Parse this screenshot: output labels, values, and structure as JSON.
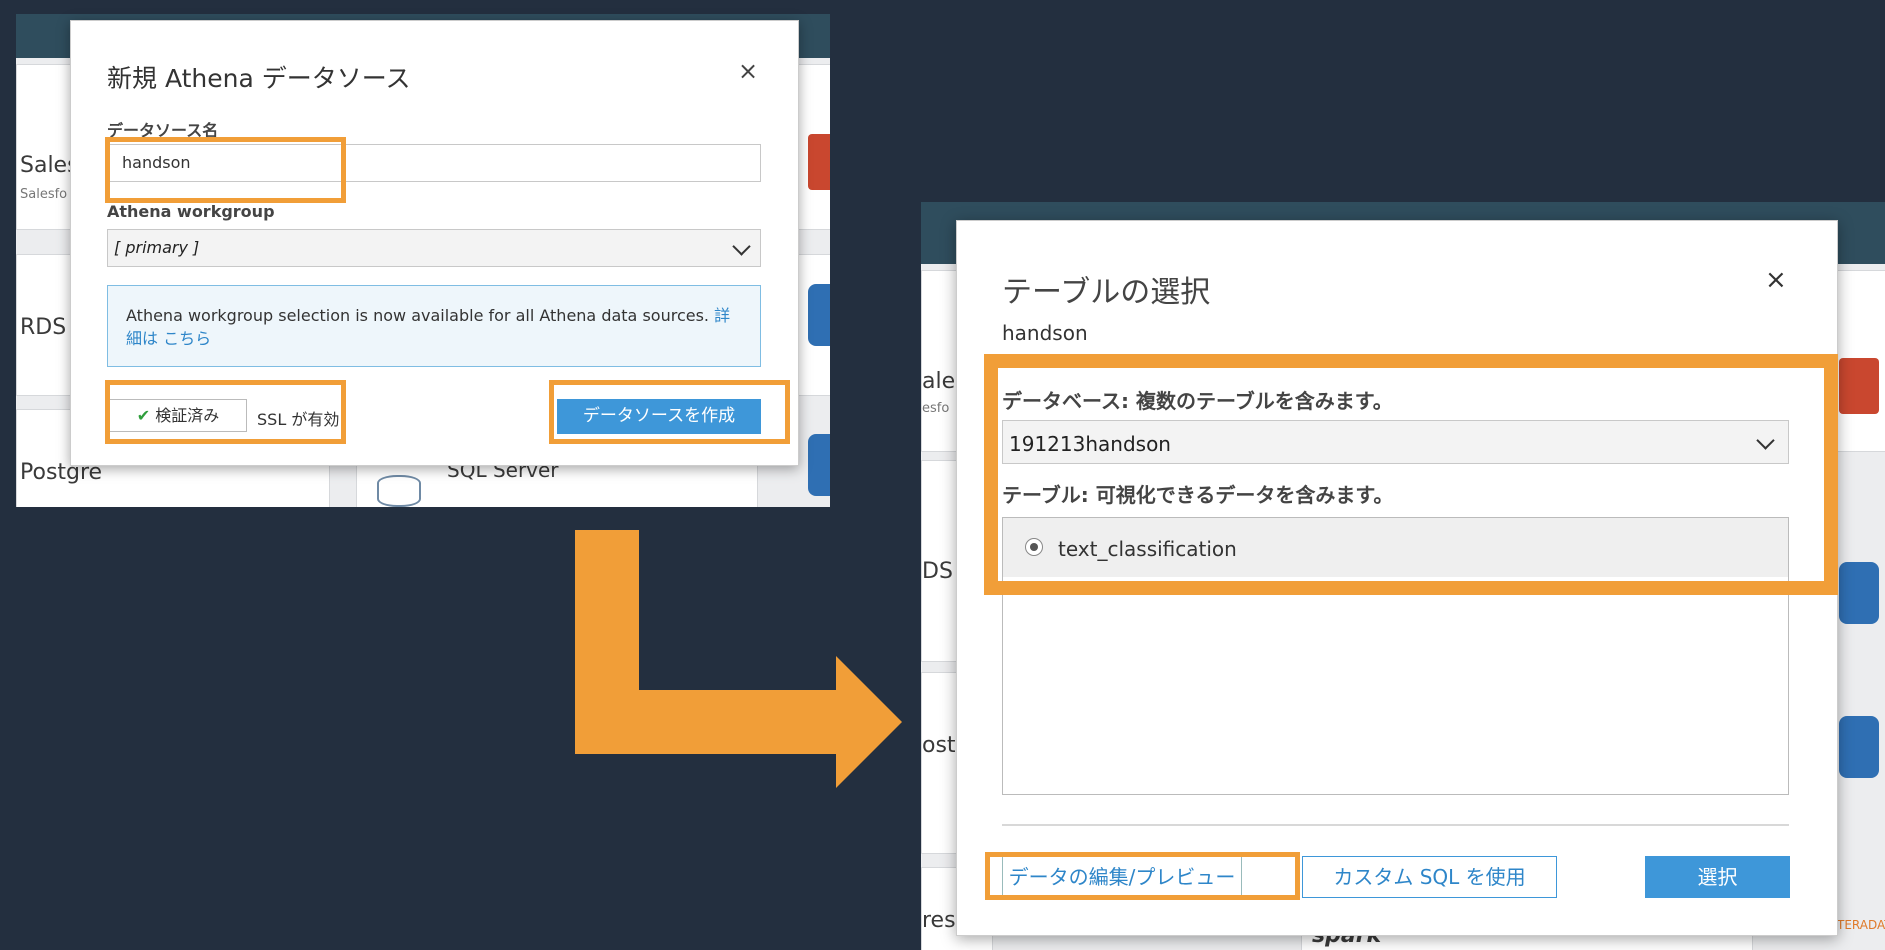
{
  "left_background": {
    "cards": [
      {
        "title": "Sales",
        "sub": "Salesfo"
      },
      {
        "title": "RDS"
      },
      {
        "title": "Postgre",
        "sub2": "SQL Server"
      }
    ]
  },
  "modal_left": {
    "title": "新規 Athena データソース",
    "close": "×",
    "datasource_label": "データソース名",
    "datasource_value": "handson",
    "workgroup_label": "Athena workgroup",
    "workgroup_value": "[ primary ]",
    "info_text": "Athena workgroup selection is now available for all Athena data sources. ",
    "info_link": "詳細は こちら",
    "verified_button": "検証済み",
    "verified_icon": "✔",
    "ssl_text": "SSL が有効",
    "create_button": "データソースを作成"
  },
  "right_background": {
    "cards": [
      {
        "title": "ales",
        "sub": "esfo"
      },
      {
        "title": "DS"
      },
      {
        "title": "ostg"
      },
      {
        "title": "rest"
      },
      {
        "title": "spark"
      },
      {
        "title": "TERADATA"
      }
    ]
  },
  "modal_right": {
    "title": "テーブルの選択",
    "close": "×",
    "subtitle": "handson",
    "database_label": "データベース: 複数のテーブルを含みます。",
    "database_value": "191213handson",
    "table_label": "テーブル: 可視化できるデータを含みます。",
    "tables": [
      {
        "name": "text_classification",
        "selected": true
      }
    ],
    "edit_preview_button": "データの編集/プレビュー",
    "custom_sql_button": "カスタム SQL を使用",
    "select_button": "選択"
  },
  "colors": {
    "background": "#232f3f",
    "highlight_orange": "#f19e38",
    "primary_blue": "#3e97d9"
  }
}
